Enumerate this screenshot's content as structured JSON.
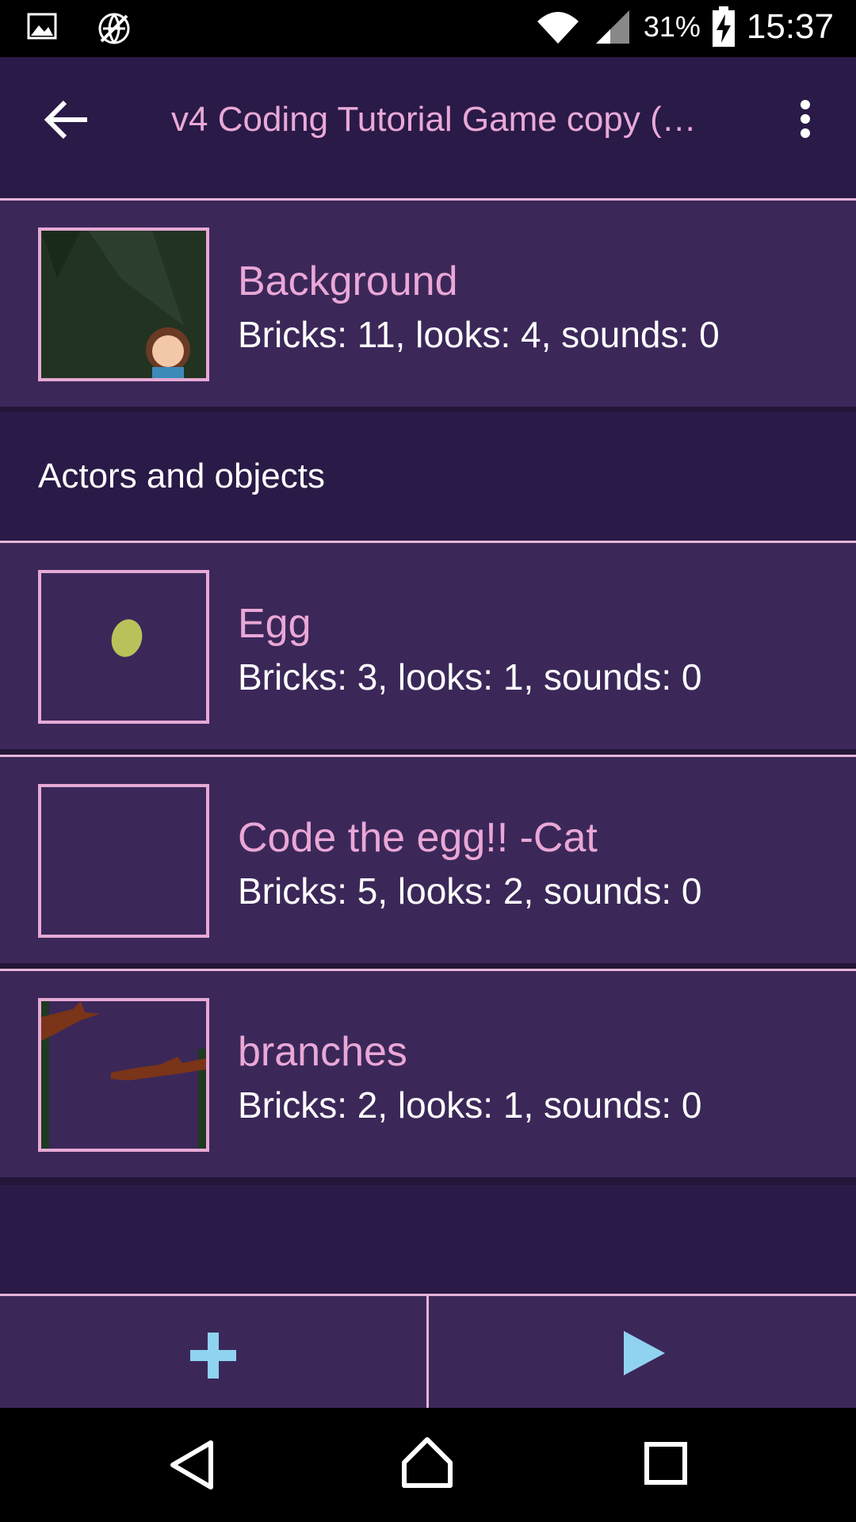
{
  "status_bar": {
    "battery_percent": "31%",
    "time": "15:37",
    "icons": [
      "image-icon",
      "no-data-icon",
      "wifi-icon",
      "signal-icon",
      "battery-charging-icon"
    ]
  },
  "app_bar": {
    "title": "v4 Coding Tutorial Game copy (…"
  },
  "background_row": {
    "name": "Background",
    "meta": "Bricks: 11, looks: 4, sounds: 0"
  },
  "section": {
    "label": "Actors and objects"
  },
  "objects": [
    {
      "name": "Egg",
      "meta": "Bricks: 3, looks: 1, sounds: 0"
    },
    {
      "name": "Code the egg!! -Cat",
      "meta": "Bricks: 5, looks: 2, sounds: 0"
    },
    {
      "name": "branches",
      "meta": "Bricks: 2, looks: 1, sounds: 0"
    }
  ],
  "colors": {
    "accent_pink": "#e9a9d8",
    "action_blue": "#8fd3f0",
    "row_bg": "#3b2859",
    "page_bg": "#2a1a47"
  }
}
